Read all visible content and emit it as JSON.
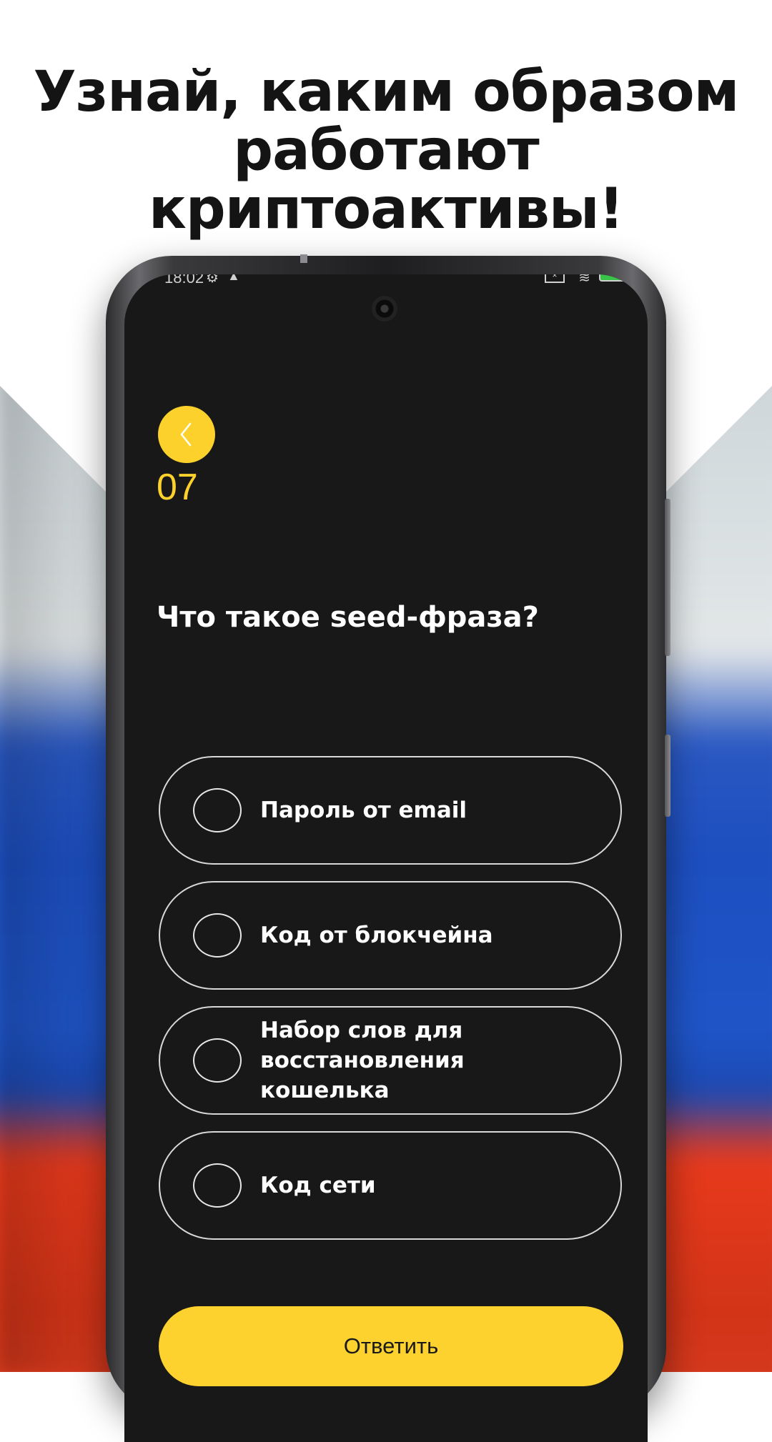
{
  "promo": {
    "headline_line1": "Узнай, каким образом",
    "headline_line2": "работают",
    "headline_line3": "криптоактивы!"
  },
  "status_bar": {
    "time": "18:02",
    "battery": "100"
  },
  "quiz": {
    "question_number": "07",
    "question": "Что такое seed-фраза?",
    "options": [
      {
        "label": "Пароль от email",
        "selected": false
      },
      {
        "label": "Код от блокчейна",
        "selected": false
      },
      {
        "label": "Набор слов для восстановления кошелька",
        "selected": false
      },
      {
        "label": "Код сети",
        "selected": false
      }
    ],
    "submit_label": "Ответить"
  },
  "colors": {
    "accent": "#fcd12c",
    "screen_background": "#181818",
    "headline": "#141414"
  }
}
